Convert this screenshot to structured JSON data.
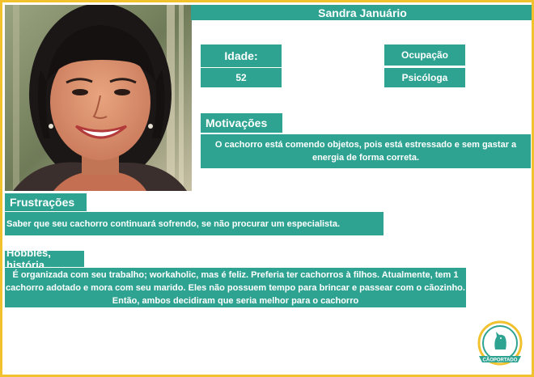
{
  "persona": {
    "name": "Sandra Januário",
    "idade_label": "Idade:",
    "idade_value": "52",
    "ocupacao_label": "Ocupação",
    "ocupacao_value": "Psicóloga"
  },
  "sections": {
    "motivacoes_title": "Motivações",
    "motivacoes_text": "O cachorro está comendo objetos, pois está estressado e sem gastar a energia de forma correta.",
    "frustracoes_title": "Frustrações",
    "frustracoes_text": "Saber que seu cachorro continuará sofrendo, se não procurar um especialista.",
    "hobbies_title": "Hobbies, história",
    "hobbies_text": "É organizada com seu trabalho; workaholic, mas é feliz. Preferia ter cachorros à filhos. Atualmente, tem 1 cachorro adotado e mora com seu marido. Eles não possuem tempo para brincar e passear com o cãozinho. Então, ambos decidiram que seria melhor para o cachorro"
  },
  "logo": {
    "text": "CÃOPORTADO"
  },
  "colors": {
    "accent": "#2fa392",
    "border": "#f2c12e"
  }
}
